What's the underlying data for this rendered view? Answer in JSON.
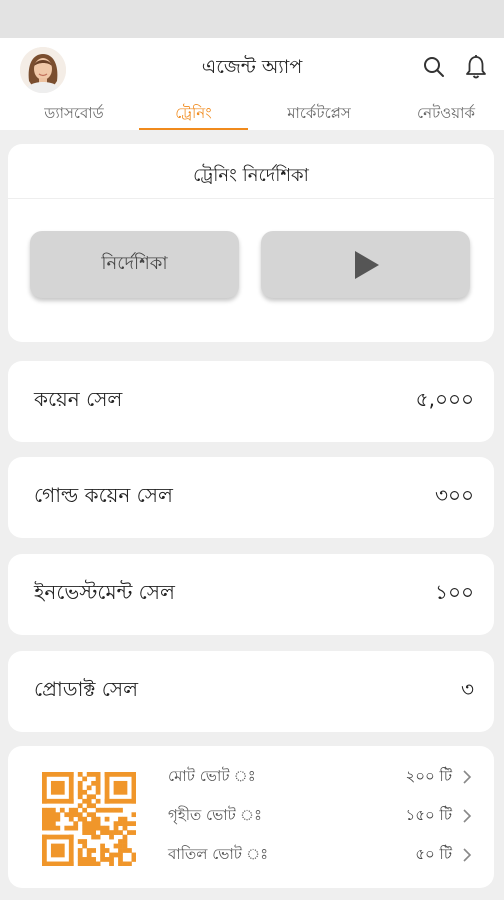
{
  "app": {
    "title": "এজেন্ট অ্যাপ"
  },
  "tabs": [
    {
      "label": "ড্যাসবোর্ড"
    },
    {
      "label": "ট্রেনিং",
      "active": true
    },
    {
      "label": "মার্কেটপ্লেস"
    },
    {
      "label": "নেটওয়ার্ক"
    }
  ],
  "training": {
    "title": "ট্রেনিং নির্দেশিকা",
    "guide_label": "নির্দেশিকা",
    "video_icon": "play-icon"
  },
  "stats": [
    {
      "label": "কয়েন সেল",
      "value": "৫,০০০"
    },
    {
      "label": "গোল্ড কয়েন সেল",
      "value": "৩০০"
    },
    {
      "label": "ইনভেস্টমেন্ট সেল",
      "value": "১০০"
    },
    {
      "label": "প্রোডাক্ট সেল",
      "value": "৩"
    }
  ],
  "votes": [
    {
      "label": "মোট ভোট ঃ",
      "value": "২০০ টি"
    },
    {
      "label": "গৃহীত ভোট ঃ",
      "value": "১৫০ টি"
    },
    {
      "label": "বাতিল ভোট ঃ",
      "value": "৫০ টি"
    }
  ],
  "colors": {
    "accent": "#f08a1c",
    "qr": "#f0962a"
  },
  "icons": [
    "search-icon",
    "bell-icon",
    "play-icon",
    "qr-code-icon",
    "chevron-right-icon"
  ]
}
